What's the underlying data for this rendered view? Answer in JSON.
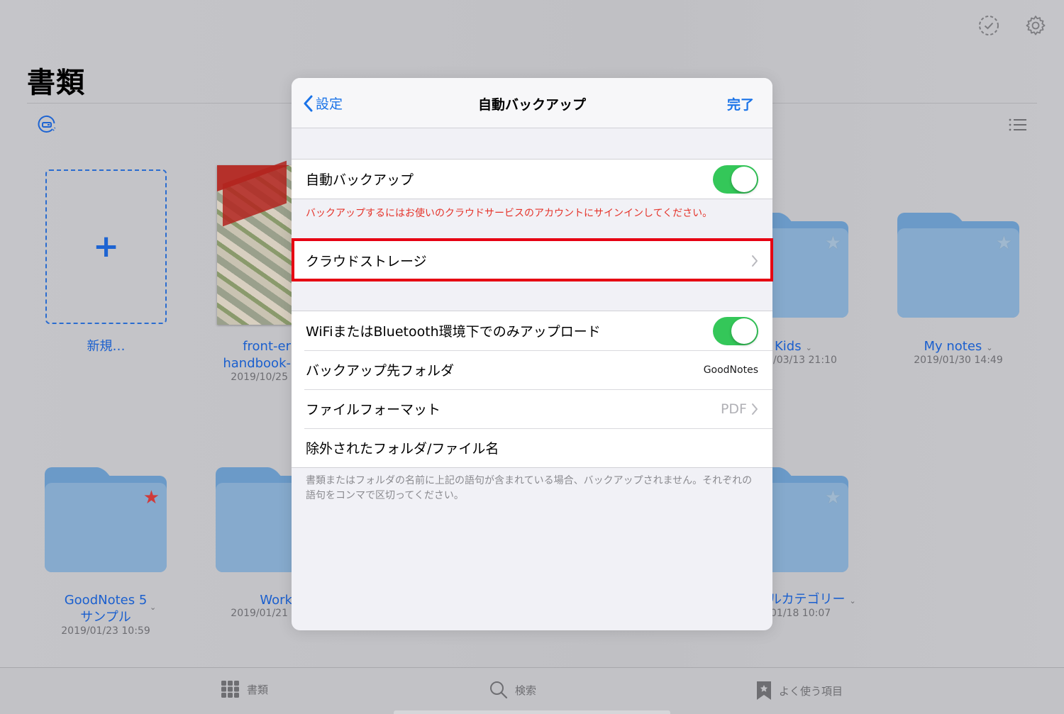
{
  "header": {
    "title": "書類",
    "select_icon": "checkmark-circle-dashed-icon",
    "settings_icon": "gear-icon",
    "sort_icon": "sort-icon",
    "view_icon": "list-view-icon"
  },
  "grid": {
    "new_item": {
      "label": "新規…",
      "icon": "plus-icon"
    },
    "items": [
      {
        "type": "document",
        "title_line1": "front-er",
        "title_line2": "handbook-",
        "date": "2019/10/25"
      },
      {
        "type": "folder",
        "title": "Kids",
        "date": "/03/13 21:10",
        "favorite": false
      },
      {
        "type": "folder",
        "title": "My notes",
        "date": "2019/01/30 14:49",
        "favorite": false
      },
      {
        "type": "folder",
        "title_line1": "GoodNotes 5",
        "title_line2": "サンプル",
        "date": "2019/01/23 10:59",
        "favorite": true
      },
      {
        "type": "folder",
        "title": "Work",
        "date": "2019/01/21",
        "favorite": false
      },
      {
        "type": "folder",
        "title": "ルカテゴリー",
        "date": "01/18 10:07",
        "favorite": false
      }
    ]
  },
  "modal": {
    "back_label": "設定",
    "title": "自動バックアップ",
    "done_label": "完了",
    "group1": {
      "auto_backup": {
        "label": "自動バックアップ",
        "on": true
      }
    },
    "warning": "バックアップするにはお使いのクラウドサービスのアカウントにサインインしてください。",
    "cloud_storage": {
      "label": "クラウドストレージ"
    },
    "group2": {
      "wifi_only": {
        "label": "WiFiまたはBluetooth環境下でのみアップロード",
        "on": true
      },
      "backup_folder": {
        "label": "バックアップ先フォルダ",
        "value": "GoodNotes"
      },
      "file_format": {
        "label": "ファイルフォーマット",
        "value": "PDF"
      },
      "excluded": {
        "label": "除外されたフォルダ/ファイル名"
      }
    },
    "footer_note": "書類またはフォルダの名前に上記の語句が含まれている場合、バックアップされません。それぞれの語句をコンマで区切ってください。"
  },
  "tabbar": {
    "documents": "書類",
    "search": "検索",
    "favorites": "よく使う項目"
  },
  "colors": {
    "accent": "#1a73e8",
    "toggle_on": "#34c759",
    "warning": "#e5332a",
    "highlight": "#e60012"
  }
}
